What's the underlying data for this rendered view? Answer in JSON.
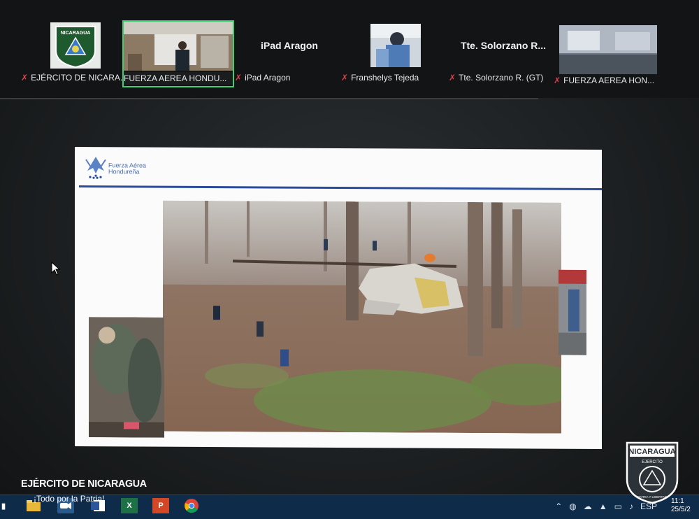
{
  "participants": [
    {
      "name": "EJÉRCITO DE NICARA...",
      "video_label": "",
      "active": false,
      "muted": true,
      "kind": "logo"
    },
    {
      "name": "FUERZA AEREA HONDU...",
      "video_label": "",
      "active": true,
      "muted": false,
      "kind": "video"
    },
    {
      "name": "iPad Aragon",
      "video_label": "iPad Aragon",
      "active": false,
      "muted": true,
      "kind": "name"
    },
    {
      "name": "Franshelys Tejeda",
      "video_label": "",
      "active": false,
      "muted": true,
      "kind": "video"
    },
    {
      "name": "Tte. Solorzano R. (GT)",
      "video_label": "Tte. Solorzano R...",
      "active": false,
      "muted": true,
      "kind": "name"
    },
    {
      "name": "FUERZA AEREA HON...",
      "video_label": "",
      "active": false,
      "muted": true,
      "kind": "video"
    }
  ],
  "participant_logo_text": "NICARAGUA",
  "slide": {
    "org_line1": "Fuerza Aérea",
    "org_line2": "Hondureña"
  },
  "taskbar": {
    "icons": [
      "file-explorer-icon",
      "zoom-icon",
      "word-icon",
      "excel-icon",
      "powerpoint-icon",
      "chrome-icon"
    ],
    "excel_letter": "X",
    "powerpoint_letter": "P",
    "tray_lang": "ESP",
    "clock_time": "11:1",
    "clock_date": "25/5/2"
  },
  "watermark": {
    "title": "EJÉRCITO DE NICARAGUA",
    "subtitle": "¡Todo por la Patria!"
  },
  "crest": {
    "top_text": "NICARAGUA",
    "mid_text": "EJERCITO",
    "motto": "PATRIA Y LIBERTAD"
  },
  "colors": {
    "active_tile": "#3ecf75",
    "mic_off": "#e0424a",
    "slide_rule": "#2b4c9a",
    "taskbar": "#0f2b4a"
  }
}
